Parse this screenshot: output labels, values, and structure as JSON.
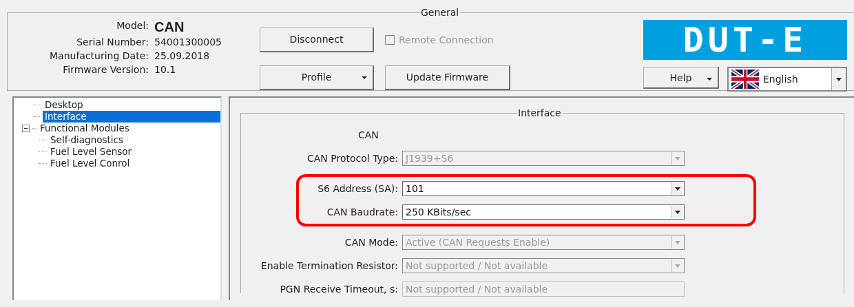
{
  "general": {
    "title": "General",
    "info": [
      {
        "label": "Model:",
        "value": "CAN",
        "kind": "bold"
      },
      {
        "label": "Serial Number:",
        "value": "54001300005",
        "kind": "plain"
      },
      {
        "label": "Manufacturing Date:",
        "value": "25.09.2018",
        "kind": "plain"
      },
      {
        "label": "Firmware Version:",
        "value": "10.1",
        "kind": "plain"
      }
    ],
    "disconnect": "Disconnect",
    "remote": {
      "label": "Remote Connection",
      "checked": false,
      "disabled": true
    },
    "profile": "Profile",
    "update": "Update Firmware",
    "logo": "DUT-E",
    "help": "Help",
    "language": "English"
  },
  "tree": [
    {
      "label": "Desktop",
      "selected": false
    },
    {
      "label": "Interface",
      "selected": true
    },
    {
      "label": "Functional Modules",
      "selected": false,
      "expanded": true,
      "children": [
        {
          "label": "Self-diagnostics",
          "selected": false
        },
        {
          "label": "Fuel Level Sensor",
          "selected": false
        },
        {
          "label": "Fuel Level Conrol",
          "selected": false
        }
      ]
    }
  ],
  "interface": {
    "title": "Interface",
    "heading": "CAN",
    "fields": [
      {
        "label": "CAN Protocol Type:",
        "value": "J1939+S6",
        "kind": "combo",
        "disabled": true,
        "highlighted": false
      },
      {
        "label": "S6 Address (SA):",
        "value": "101",
        "kind": "combo",
        "disabled": false,
        "highlighted": true
      },
      {
        "label": "CAN Baudrate:",
        "value": "250 KBits/sec",
        "kind": "combo",
        "disabled": false,
        "highlighted": true
      },
      {
        "label": "CAN Mode:",
        "value": "Active (CAN Requests Enable)",
        "kind": "combo",
        "disabled": true,
        "highlighted": false
      },
      {
        "label": "Enable Termination Resistor:",
        "value": "Not supported / Not available",
        "kind": "combo",
        "disabled": true,
        "highlighted": false
      },
      {
        "label": "PGN Receive Timeout, s:",
        "value": "Not supported / Not available",
        "kind": "text",
        "disabled": true,
        "highlighted": false
      }
    ]
  }
}
